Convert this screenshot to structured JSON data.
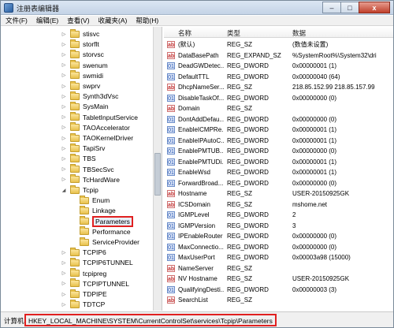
{
  "window": {
    "title": "注册表编辑器",
    "controls": [
      "–",
      "□",
      "x"
    ]
  },
  "menu": [
    "文件(F)",
    "编辑(E)",
    "查看(V)",
    "收藏夹(A)",
    "帮助(H)"
  ],
  "tree": {
    "items": [
      {
        "label": "stisvc",
        "expanded": false,
        "selected": false
      },
      {
        "label": "storflt",
        "expanded": false,
        "selected": false
      },
      {
        "label": "storvsc",
        "expanded": false,
        "selected": false
      },
      {
        "label": "swenum",
        "expanded": false,
        "selected": false
      },
      {
        "label": "swmidi",
        "expanded": false,
        "selected": false
      },
      {
        "label": "swprv",
        "expanded": false,
        "selected": false
      },
      {
        "label": "Synth3dVsc",
        "expanded": false,
        "selected": false
      },
      {
        "label": "SysMain",
        "expanded": false,
        "selected": false
      },
      {
        "label": "TabletInputService",
        "expanded": false,
        "selected": false
      },
      {
        "label": "TAOAccelerator",
        "expanded": false,
        "selected": false
      },
      {
        "label": "TAOKernelDriver",
        "expanded": false,
        "selected": false
      },
      {
        "label": "TapiSrv",
        "expanded": false,
        "selected": false
      },
      {
        "label": "TBS",
        "expanded": false,
        "selected": false
      },
      {
        "label": "TBSecSvc",
        "expanded": false,
        "selected": false
      },
      {
        "label": "TcHardWare",
        "expanded": false,
        "selected": false
      },
      {
        "label": "Tcpip",
        "expanded": true,
        "selected": false
      },
      {
        "label": "Enum",
        "expanded": false,
        "selected": false,
        "child": true
      },
      {
        "label": "Linkage",
        "expanded": false,
        "selected": false,
        "child": true
      },
      {
        "label": "Parameters",
        "expanded": false,
        "selected": true,
        "child": true
      },
      {
        "label": "Performance",
        "expanded": false,
        "selected": false,
        "child": true
      },
      {
        "label": "ServiceProvider",
        "expanded": false,
        "selected": false,
        "child": true
      },
      {
        "label": "TCPIP6",
        "expanded": false,
        "selected": false
      },
      {
        "label": "TCPIP6TUNNEL",
        "expanded": false,
        "selected": false
      },
      {
        "label": "tcpipreg",
        "expanded": false,
        "selected": false
      },
      {
        "label": "TCPIPTUNNEL",
        "expanded": false,
        "selected": false
      },
      {
        "label": "TDPIPE",
        "expanded": false,
        "selected": false
      },
      {
        "label": "TDTCP",
        "expanded": false,
        "selected": false
      }
    ]
  },
  "values": {
    "headers": {
      "name": "名称",
      "type": "类型",
      "data": "数据"
    },
    "rows": [
      {
        "name": "(默认)",
        "type": "REG_SZ",
        "data": "(数值未设置)",
        "kind": "sz"
      },
      {
        "name": "DataBasePath",
        "type": "REG_EXPAND_SZ",
        "data": "%SystemRoot%\\System32\\dri",
        "kind": "sz"
      },
      {
        "name": "DeadGWDetec...",
        "type": "REG_DWORD",
        "data": "0x00000001 (1)",
        "kind": "dw"
      },
      {
        "name": "DefaultTTL",
        "type": "REG_DWORD",
        "data": "0x00000040 (64)",
        "kind": "dw"
      },
      {
        "name": "DhcpNameSer...",
        "type": "REG_SZ",
        "data": "218.85.152.99 218.85.157.99",
        "kind": "sz"
      },
      {
        "name": "DisableTaskOf...",
        "type": "REG_DWORD",
        "data": "0x00000000 (0)",
        "kind": "dw"
      },
      {
        "name": "Domain",
        "type": "REG_SZ",
        "data": "",
        "kind": "sz"
      },
      {
        "name": "DontAddDefau...",
        "type": "REG_DWORD",
        "data": "0x00000000 (0)",
        "kind": "dw"
      },
      {
        "name": "EnableICMPRe...",
        "type": "REG_DWORD",
        "data": "0x00000001 (1)",
        "kind": "dw"
      },
      {
        "name": "EnableIPAutoC...",
        "type": "REG_DWORD",
        "data": "0x00000001 (1)",
        "kind": "dw"
      },
      {
        "name": "EnablePMTUB...",
        "type": "REG_DWORD",
        "data": "0x00000000 (0)",
        "kind": "dw"
      },
      {
        "name": "EnablePMTUDi...",
        "type": "REG_DWORD",
        "data": "0x00000001 (1)",
        "kind": "dw"
      },
      {
        "name": "EnableWsd",
        "type": "REG_DWORD",
        "data": "0x00000001 (1)",
        "kind": "dw"
      },
      {
        "name": "ForwardBroad...",
        "type": "REG_DWORD",
        "data": "0x00000000 (0)",
        "kind": "dw"
      },
      {
        "name": "Hostname",
        "type": "REG_SZ",
        "data": "USER-20150925GK",
        "kind": "sz"
      },
      {
        "name": "ICSDomain",
        "type": "REG_SZ",
        "data": "mshome.net",
        "kind": "sz"
      },
      {
        "name": "IGMPLevel",
        "type": "REG_DWORD",
        "data": "2",
        "kind": "dw"
      },
      {
        "name": "IGMPVersion",
        "type": "REG_DWORD",
        "data": "3",
        "kind": "dw"
      },
      {
        "name": "IPEnableRouter",
        "type": "REG_DWORD",
        "data": "0x00000000 (0)",
        "kind": "dw"
      },
      {
        "name": "MaxConnectio...",
        "type": "REG_DWORD",
        "data": "0x00000000 (0)",
        "kind": "dw"
      },
      {
        "name": "MaxUserPort",
        "type": "REG_DWORD",
        "data": "0x00003a98 (15000)",
        "kind": "dw"
      },
      {
        "name": "NameServer",
        "type": "REG_SZ",
        "data": "",
        "kind": "sz"
      },
      {
        "name": "NV Hostname",
        "type": "REG_SZ",
        "data": "USER-20150925GK",
        "kind": "sz"
      },
      {
        "name": "QualifyingDesti...",
        "type": "REG_DWORD",
        "data": "0x00000003 (3)",
        "kind": "dw"
      },
      {
        "name": "SearchList",
        "type": "REG_SZ",
        "data": "",
        "kind": "sz"
      }
    ]
  },
  "status": {
    "prefix": "计算机",
    "path": "HKEY_LOCAL_MACHINE\\SYSTEM\\CurrentControlSet\\services\\Tcpip\\Parameters"
  },
  "colors": {
    "highlight": "#e02020",
    "selection_bg": "#e8f0fb"
  }
}
